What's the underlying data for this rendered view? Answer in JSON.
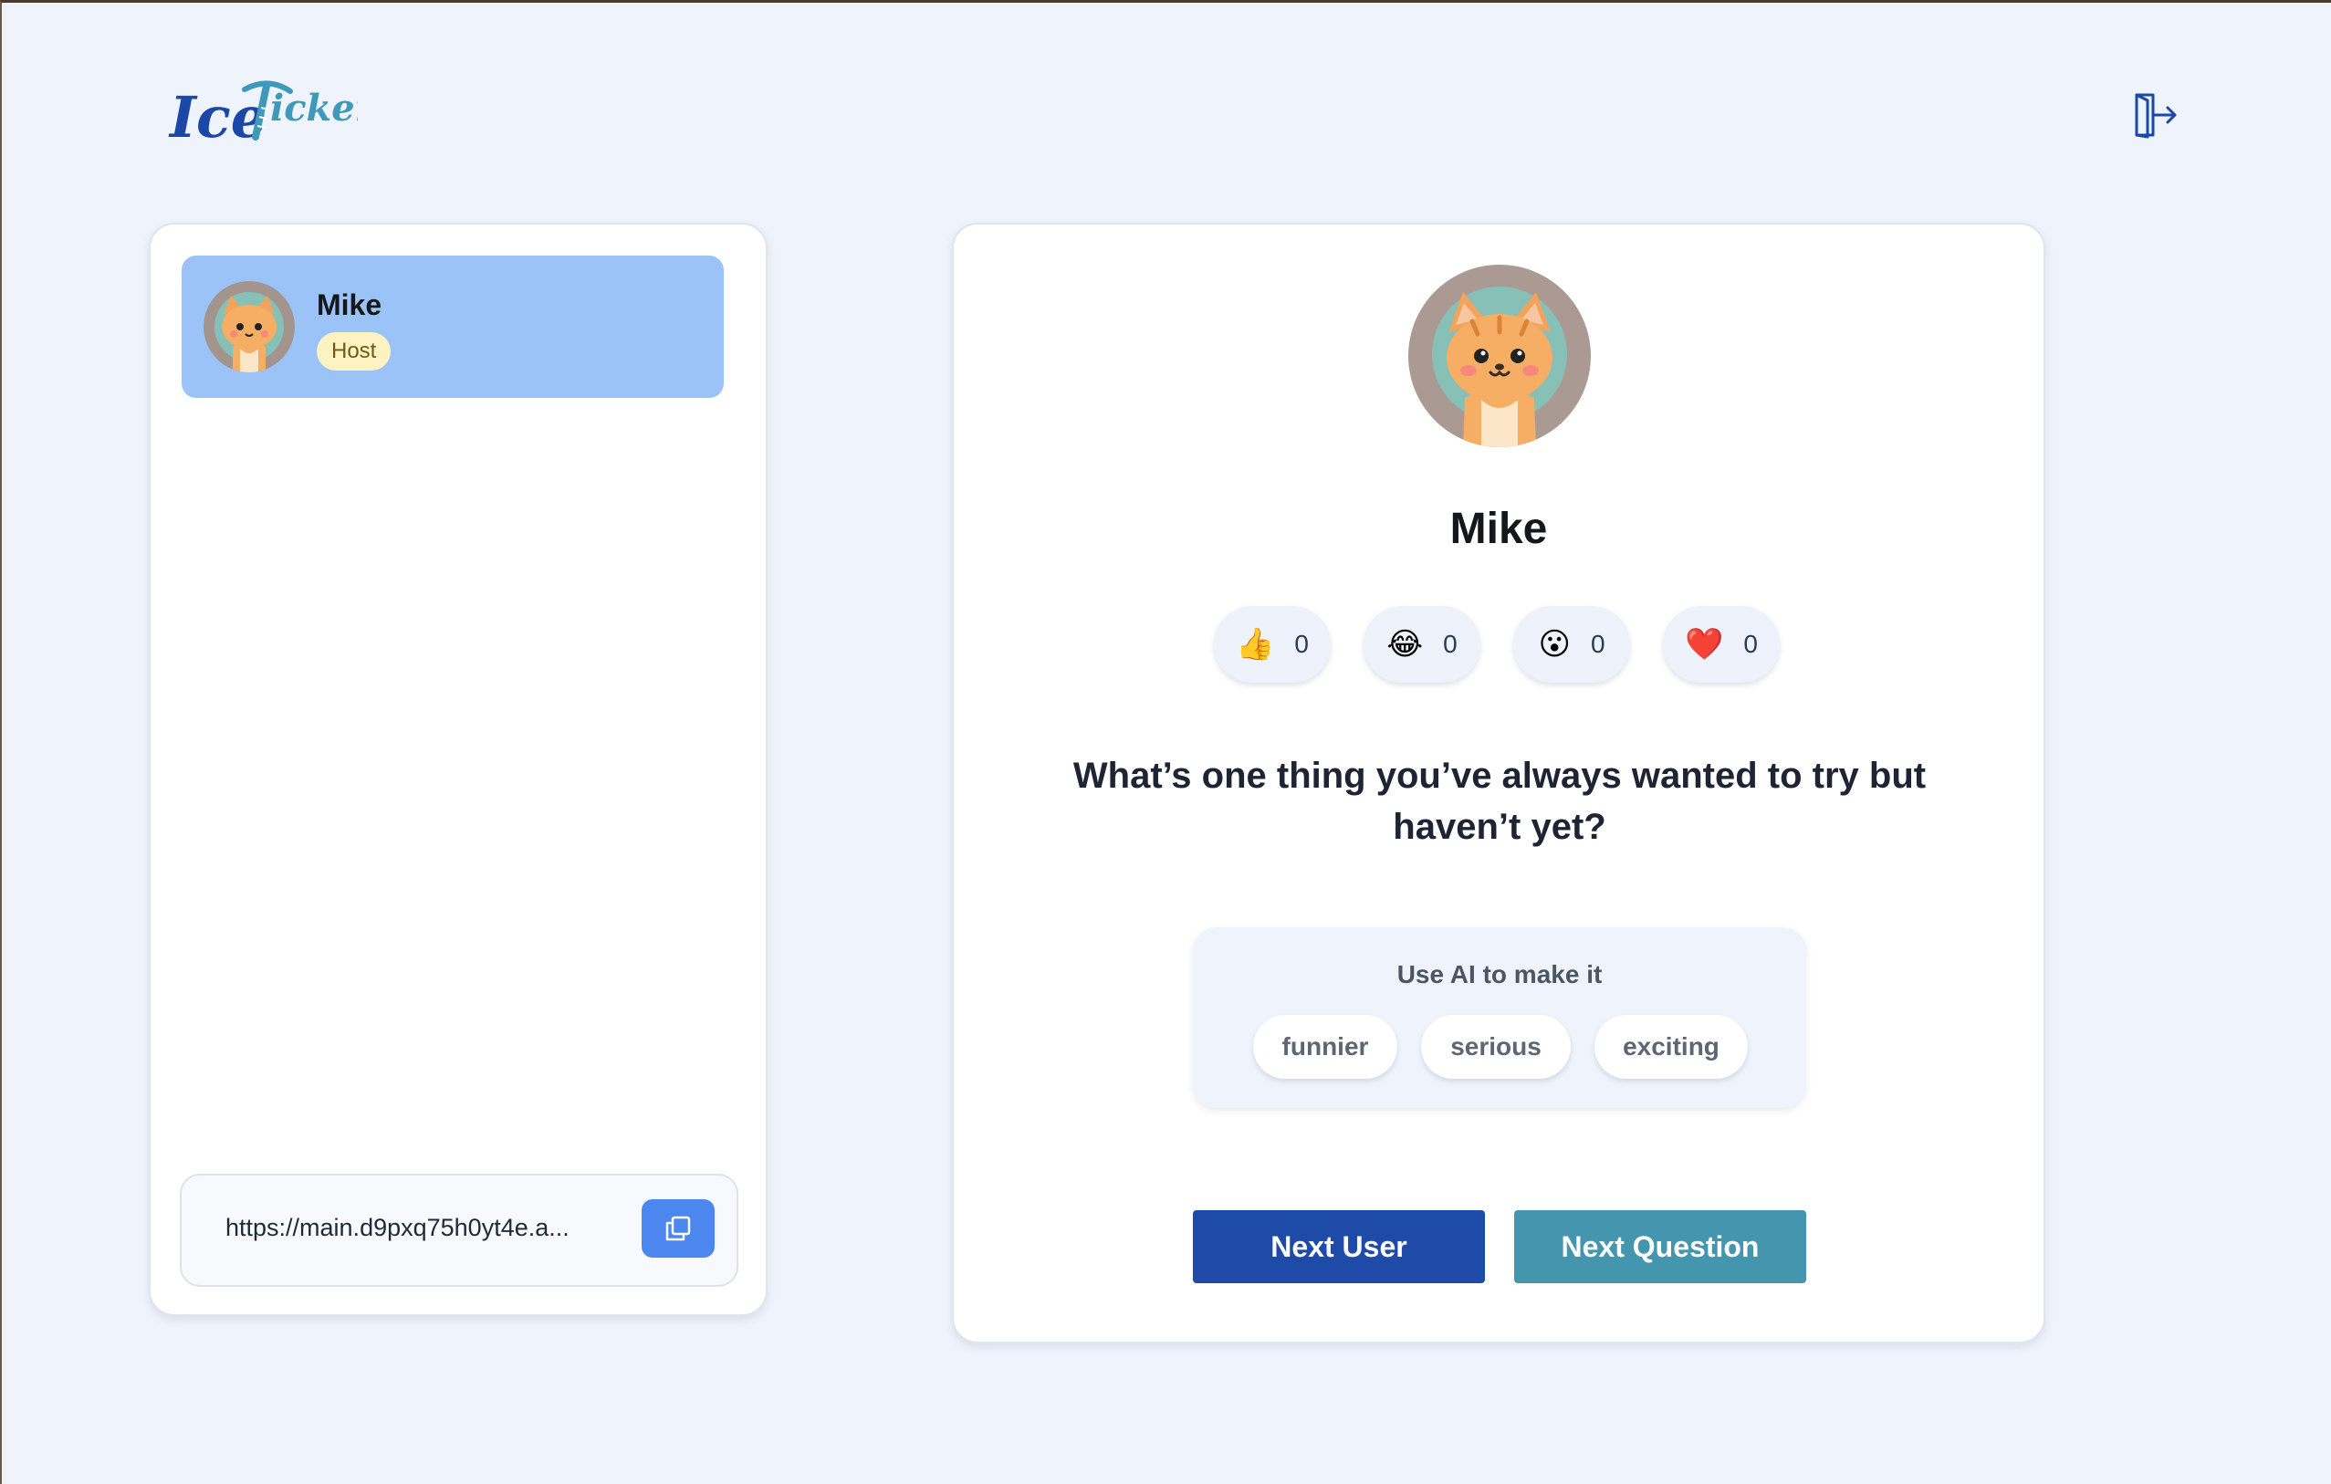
{
  "app": {
    "logo_text_ice": "Ice",
    "logo_text_rest": "icker"
  },
  "header": {
    "logout_icon": "logout-door-icon"
  },
  "sidebar": {
    "players": [
      {
        "name": "Mike",
        "role_badge": "Host",
        "avatar_icon": "cat-avatar-icon"
      }
    ],
    "invite_link": "https://main.d9pxq75h0yt4e.a...",
    "copy_icon": "copy-icon"
  },
  "main": {
    "current_user": {
      "name": "Mike",
      "avatar_icon": "cat-avatar-icon"
    },
    "reactions": [
      {
        "emoji": "👍",
        "icon": "thumbs-up-icon",
        "count": "0"
      },
      {
        "emoji": "😂",
        "icon": "laughing-icon",
        "count": "0"
      },
      {
        "emoji": "😮",
        "icon": "surprised-icon",
        "count": "0"
      },
      {
        "emoji": "❤️",
        "icon": "heart-icon",
        "count": "0"
      }
    ],
    "question": "What’s one thing you’ve always wanted to try but haven’t yet?",
    "ai": {
      "label": "Use AI to make it",
      "options": [
        "funnier",
        "serious",
        "exciting"
      ]
    },
    "buttons": {
      "next_user": "Next User",
      "next_question": "Next Question"
    }
  },
  "colors": {
    "background": "#eff4fc",
    "active_player": "#9cc3f7",
    "primary": "#1e4aa8",
    "secondary": "#4396ae",
    "copy_button": "#4b87ee",
    "host_badge": "#fdf3c2"
  }
}
